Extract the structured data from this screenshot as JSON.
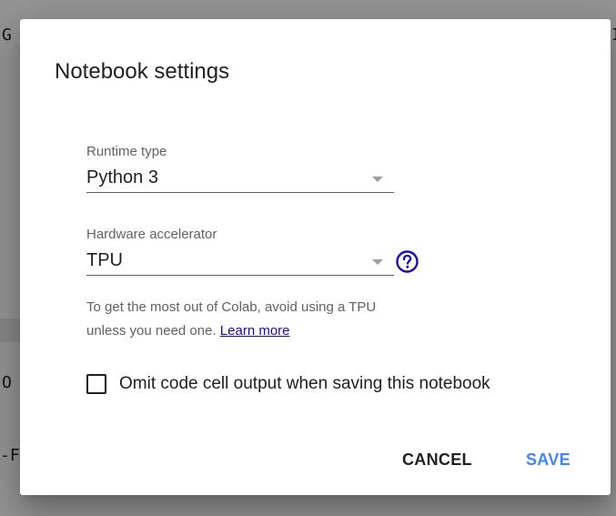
{
  "background": {
    "top_left_char": "G",
    "top_right_char": "I",
    "left_char_1": "O",
    "left_char_2": "-F",
    "bottom_text": "..."
  },
  "dialog": {
    "title": "Notebook settings",
    "runtime": {
      "label": "Runtime type",
      "value": "Python 3"
    },
    "accelerator": {
      "label": "Hardware accelerator",
      "value": "TPU"
    },
    "help_icon": "help-circle-icon",
    "hint": {
      "text": "To get the most out of Colab, avoid using a TPU unless you need one.",
      "link": "Learn more"
    },
    "omit_output": {
      "label": "Omit code cell output when saving this notebook",
      "checked": false
    },
    "buttons": {
      "cancel": "CANCEL",
      "save": "SAVE"
    }
  },
  "colors": {
    "accent": "#4285f4",
    "help_icon": "#1a0dab",
    "link": "#1a0dab"
  }
}
